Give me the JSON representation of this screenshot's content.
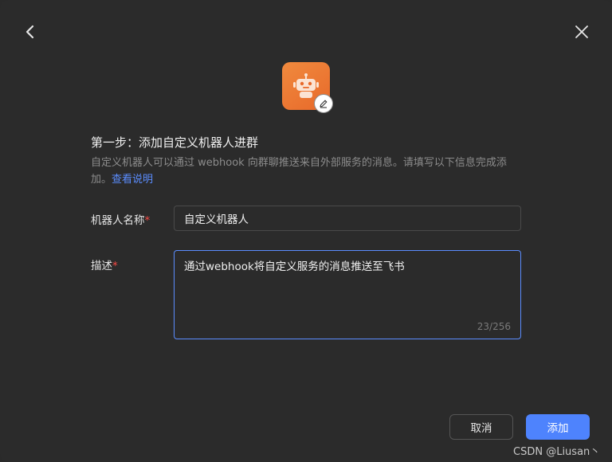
{
  "nav": {
    "back_icon": "chevron-left-icon",
    "close_icon": "close-icon"
  },
  "bot": {
    "icon": "robot-icon",
    "edit_icon": "pencil-icon",
    "avatar_color": "#ec7a36"
  },
  "step": {
    "title": "第一步：添加自定义机器人进群",
    "desc": "自定义机器人可以通过 webhook 向群聊推送来自外部服务的消息。请填写以下信息完成添加。",
    "link": "查看说明"
  },
  "form": {
    "name_label": "机器人名称",
    "name_value": "自定义机器人",
    "desc_label": "描述",
    "desc_value": "通过webhook将自定义服务的消息推送至飞书",
    "desc_counter": "23/256",
    "required_mark": "*"
  },
  "actions": {
    "cancel_label": "取消",
    "add_label": "添加"
  },
  "watermark": "CSDN @Liusan丶",
  "colors": {
    "accent": "#4e83fd",
    "link": "#5b8dff",
    "required": "#f54a45"
  }
}
